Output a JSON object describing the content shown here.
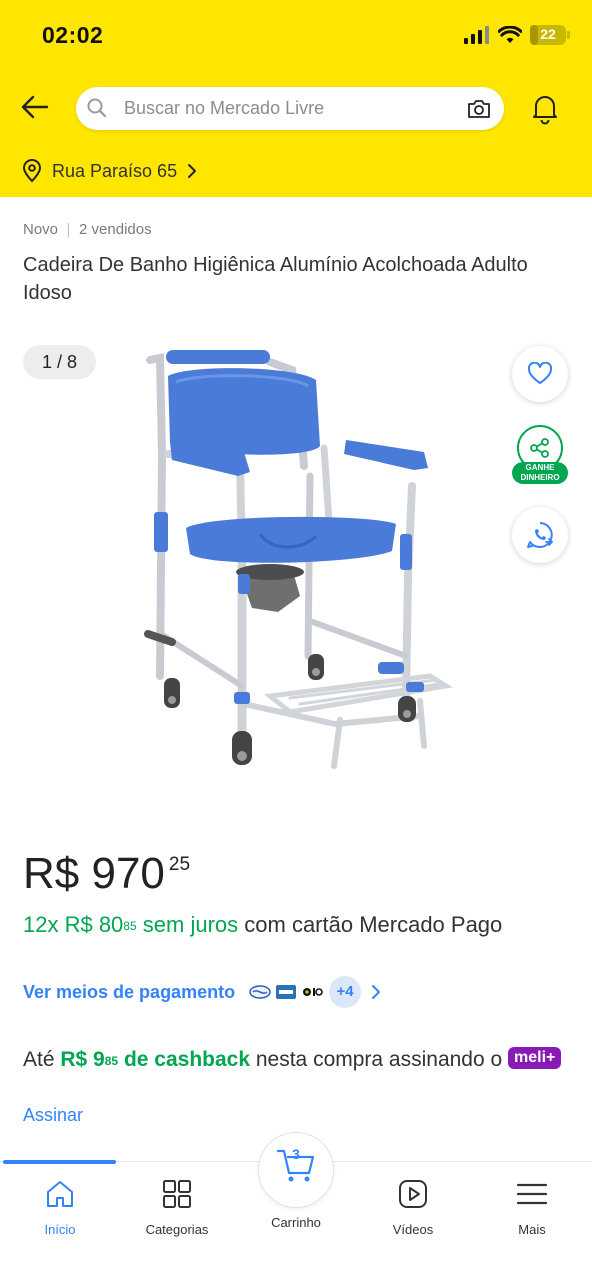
{
  "status_bar": {
    "time": "02:02",
    "battery": "22"
  },
  "header": {
    "search_placeholder": "Buscar no Mercado Livre",
    "address": "Rua Paraíso 65"
  },
  "product": {
    "condition": "Novo",
    "sold": "2 vendidos",
    "title": "Cadeira De Banho Higiênica Alumínio Acolchoada Adulto Idoso",
    "image_counter": "1 / 8",
    "earn_badge_line1": "GANHE",
    "earn_badge_line2": "DINHEIRO",
    "price_currency": "R$",
    "price_integer": "970",
    "price_cents": "25",
    "installments": {
      "count": "12x R$ 80",
      "cents": "85",
      "no_interest": "sem juros",
      "rest_line": "com cartão Mercado Pago"
    },
    "payment_methods_link": "Ver meios de pagamento",
    "more_cards": "+4",
    "cashback": {
      "prefix": "Até",
      "amount": "R$ 9",
      "cents": "85",
      "label": "de cashback",
      "suffix": "nesta compra assinando o",
      "brand": "meli+"
    },
    "subscribe_link": "Assinar"
  },
  "bottom_nav": {
    "items": [
      {
        "label": "Início"
      },
      {
        "label": "Categorias"
      },
      {
        "label": "Carrinho"
      },
      {
        "label": "Vídeos"
      },
      {
        "label": "Mais"
      }
    ],
    "cart_count": "3",
    "active": "Início"
  },
  "colors": {
    "header_yellow": "#FFE600",
    "link_blue": "#3483FA",
    "green": "#00A650",
    "meli_purple": "#8A1AB6",
    "chair_blue": "#4A7BD8"
  }
}
